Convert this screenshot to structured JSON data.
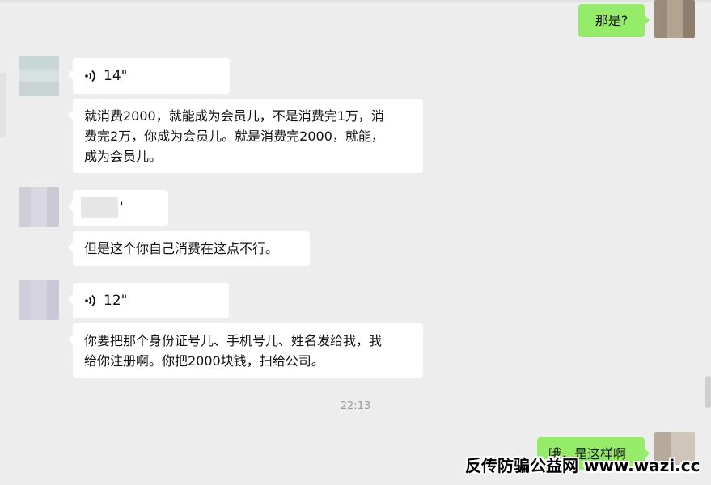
{
  "messages": [
    {
      "side": "right",
      "type": "text",
      "text": "那是?"
    },
    {
      "side": "left",
      "type": "voice",
      "duration": "14\""
    },
    {
      "side": "left",
      "type": "text",
      "lines": [
        "就消费2000，就能成为会员儿，不是消费完1万，消",
        "费完2万，你成为会员儿。就是消费完2000，就能，",
        "成为会员儿。"
      ]
    },
    {
      "side": "left",
      "type": "voice",
      "duration": "'"
    },
    {
      "side": "left",
      "type": "text",
      "text": "但是这个你自己消费在这点不行。"
    },
    {
      "side": "left",
      "type": "voice",
      "duration": "12\""
    },
    {
      "side": "left",
      "type": "text",
      "lines": [
        "你要把那个身份证号儿、手机号儿、姓名发给我，我",
        "给你注册啊。你把2000块钱，扫给公司。"
      ]
    },
    {
      "side": "right",
      "type": "text",
      "text": "哦，是这样啊"
    }
  ],
  "timestamp": "22:13",
  "watermark": "反传防骗公益网 www.wazi.cc",
  "icons": {
    "voice": "voice-wave-icon"
  },
  "colors": {
    "background": "#ededed",
    "incoming": "#ffffff",
    "outgoing": "#95ec69"
  }
}
